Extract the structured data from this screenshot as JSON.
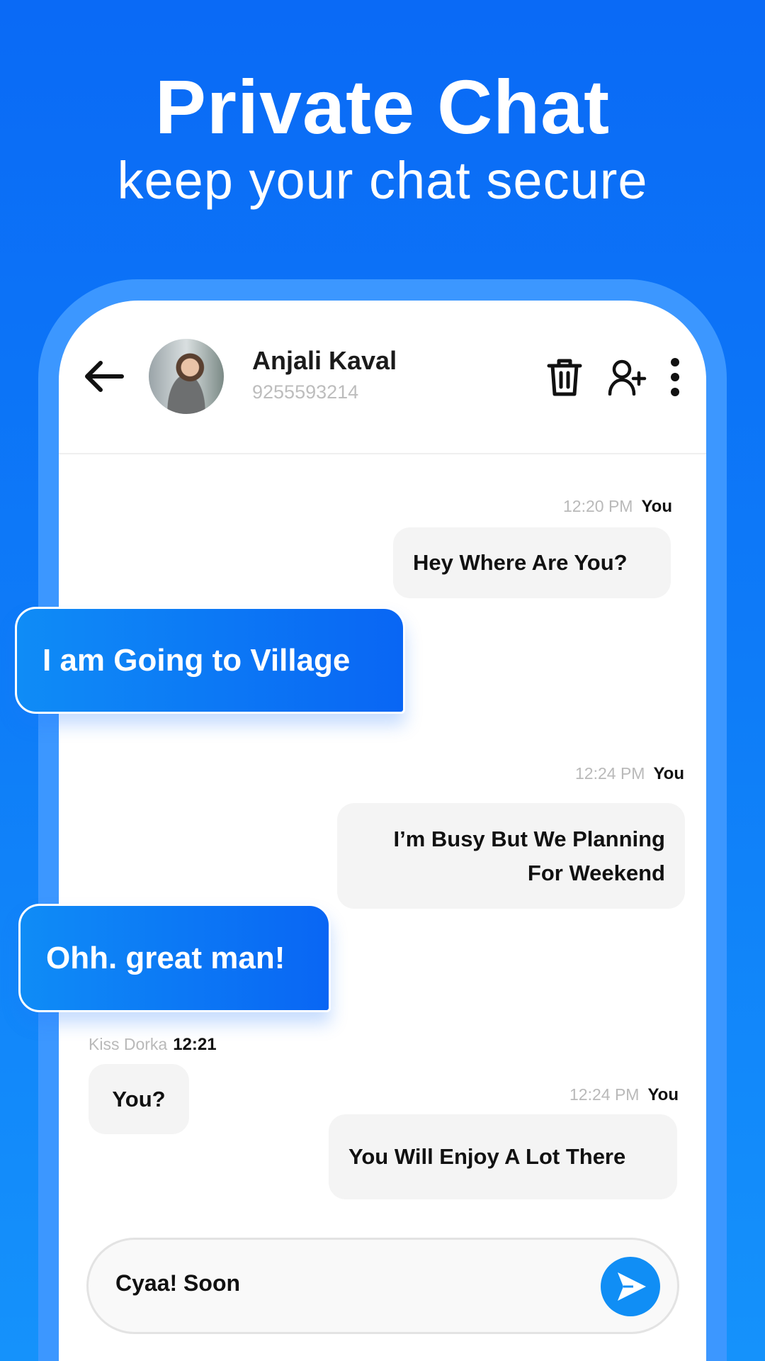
{
  "promo": {
    "title": "Private Chat",
    "subtitle": "keep your chat secure"
  },
  "header": {
    "contact_name": "Anjali Kaval",
    "contact_phone": "9255593214",
    "icons": [
      "back-arrow-icon",
      "trash-icon",
      "add-user-icon",
      "more-vertical-icon"
    ]
  },
  "messages": [
    {
      "time": "12:20 PM",
      "sender": "You",
      "text": "Hey Where Are You?"
    },
    {
      "text": "I am Going to Village",
      "style": "highlight"
    },
    {
      "time": "12:24 PM",
      "sender": "You",
      "text": "I’m Busy But We Planning For Weekend"
    },
    {
      "text": "Ohh. great man!",
      "style": "highlight"
    },
    {
      "time": "12:21",
      "sender": "Kiss Dorka",
      "text": "You?"
    },
    {
      "time": "12:24 PM",
      "sender": "You",
      "text": "You Will Enjoy A Lot There"
    }
  ],
  "composer": {
    "value": "Cyaa! Soon",
    "send_icon": "send-icon"
  },
  "colors": {
    "accent": "#108ef5",
    "background": "#0a6af6",
    "bubble": "#f4f4f4"
  }
}
